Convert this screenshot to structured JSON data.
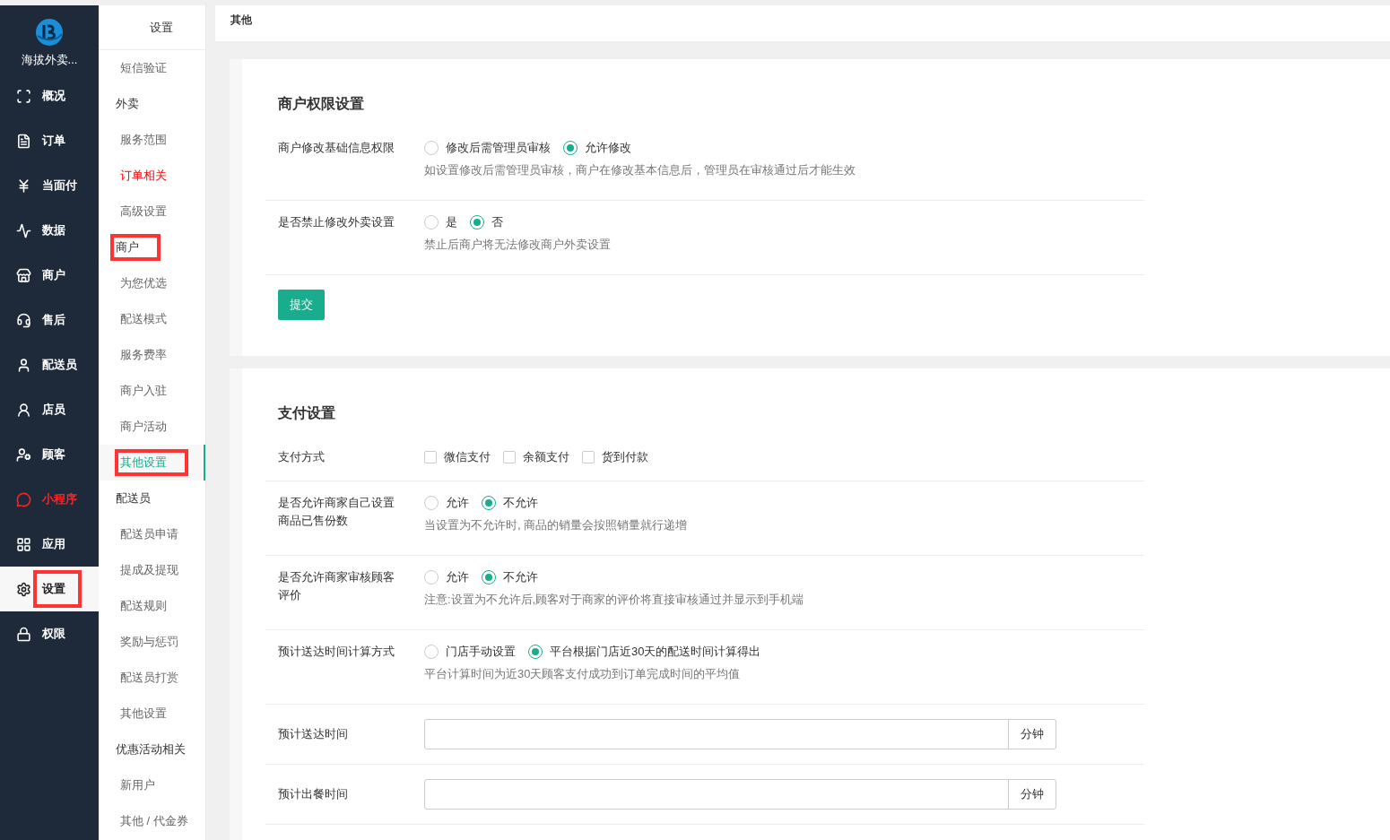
{
  "brand": {
    "name": "海拔外卖..."
  },
  "nav": [
    {
      "label": "概况",
      "selected": false,
      "highlighted": false
    },
    {
      "label": "订单",
      "selected": false,
      "highlighted": false
    },
    {
      "label": "当面付",
      "selected": false,
      "highlighted": false
    },
    {
      "label": "数据",
      "selected": false,
      "highlighted": false
    },
    {
      "label": "商户",
      "selected": false,
      "highlighted": false
    },
    {
      "label": "售后",
      "selected": false,
      "highlighted": false
    },
    {
      "label": "配送员",
      "selected": false,
      "highlighted": false
    },
    {
      "label": "店员",
      "selected": false,
      "highlighted": false
    },
    {
      "label": "顾客",
      "selected": false,
      "highlighted": false
    },
    {
      "label": "小程序",
      "selected": false,
      "highlighted": true
    },
    {
      "label": "应用",
      "selected": false,
      "highlighted": false
    },
    {
      "label": "设置",
      "selected": true,
      "highlighted": false,
      "annotated": true
    },
    {
      "label": "权限",
      "selected": false,
      "highlighted": false
    }
  ],
  "submenu": {
    "title": "设置",
    "items": [
      {
        "kind": "item",
        "label": "短信验证",
        "selected": false,
        "highlighted": false
      },
      {
        "kind": "group",
        "label": "外卖",
        "selected": false,
        "highlighted": false
      },
      {
        "kind": "item",
        "label": "服务范围",
        "selected": false,
        "highlighted": false
      },
      {
        "kind": "item",
        "label": "订单相关",
        "selected": false,
        "highlighted": true
      },
      {
        "kind": "item",
        "label": "高级设置",
        "selected": false,
        "highlighted": false
      },
      {
        "kind": "group",
        "label": "商户",
        "selected": false,
        "highlighted": false,
        "annotated": true
      },
      {
        "kind": "item",
        "label": "为您优选",
        "selected": false,
        "highlighted": false
      },
      {
        "kind": "item",
        "label": "配送模式",
        "selected": false,
        "highlighted": false
      },
      {
        "kind": "item",
        "label": "服务费率",
        "selected": false,
        "highlighted": false
      },
      {
        "kind": "item",
        "label": "商户入驻",
        "selected": false,
        "highlighted": false
      },
      {
        "kind": "item",
        "label": "商户活动",
        "selected": false,
        "highlighted": false
      },
      {
        "kind": "item",
        "label": "其他设置",
        "selected": true,
        "highlighted": false,
        "annotated": true
      },
      {
        "kind": "group",
        "label": "配送员",
        "selected": false,
        "highlighted": false
      },
      {
        "kind": "item",
        "label": "配送员申请",
        "selected": false,
        "highlighted": false
      },
      {
        "kind": "item",
        "label": "提成及提现",
        "selected": false,
        "highlighted": false
      },
      {
        "kind": "item",
        "label": "配送规则",
        "selected": false,
        "highlighted": false
      },
      {
        "kind": "item",
        "label": "奖励与惩罚",
        "selected": false,
        "highlighted": false
      },
      {
        "kind": "item",
        "label": "配送员打赏",
        "selected": false,
        "highlighted": false
      },
      {
        "kind": "item",
        "label": "其他设置",
        "selected": false,
        "highlighted": false
      },
      {
        "kind": "group",
        "label": "优惠活动相关",
        "selected": false,
        "highlighted": false
      },
      {
        "kind": "item",
        "label": "新用户",
        "selected": false,
        "highlighted": false
      },
      {
        "kind": "item",
        "label": "其他 / 代金券",
        "selected": false,
        "highlighted": false
      }
    ]
  },
  "breadcrumb": "其他",
  "sections": [
    {
      "title": "商户权限设置",
      "submit": "提交",
      "rows": [
        {
          "kind": "radio",
          "label": "商户修改基础信息权限",
          "options": [
            {
              "label": "修改后需管理员审核",
              "selected": false
            },
            {
              "label": "允许修改",
              "selected": true
            }
          ],
          "help": "如设置修改后需管理员审核，商户在修改基本信息后，管理员在审核通过后才能生效"
        },
        {
          "kind": "radio",
          "label": "是否禁止修改外卖设置",
          "options": [
            {
              "label": "是",
              "selected": false
            },
            {
              "label": "否",
              "selected": true
            }
          ],
          "help": "禁止后商户将无法修改商户外卖设置"
        }
      ]
    },
    {
      "title": "支付设置",
      "rows": [
        {
          "kind": "checkbox",
          "label": "支付方式",
          "options": [
            {
              "label": "微信支付",
              "checked": false
            },
            {
              "label": "余额支付",
              "checked": false
            },
            {
              "label": "货到付款",
              "checked": false
            }
          ]
        },
        {
          "kind": "radio",
          "label": "是否允许商家自己设置商品已售份数",
          "options": [
            {
              "label": "允许",
              "selected": false
            },
            {
              "label": "不允许",
              "selected": true
            }
          ],
          "help": "当设置为不允许时, 商品的销量会按照销量就行递增"
        },
        {
          "kind": "radio",
          "label": "是否允许商家审核顾客评价",
          "options": [
            {
              "label": "允许",
              "selected": false
            },
            {
              "label": "不允许",
              "selected": true
            }
          ],
          "help": "注意:设置为不允许后,顾客对于商家的评价将直接审核通过并显示到手机端"
        },
        {
          "kind": "radio",
          "label": "预计送达时间计算方式",
          "options": [
            {
              "label": "门店手动设置",
              "selected": false
            },
            {
              "label": "平台根据门店近30天的配送时间计算得出",
              "selected": true
            }
          ],
          "help": "平台计算时间为近30天顾客支付成功到订单完成时间的平均值"
        },
        {
          "kind": "input",
          "label": "预计送达时间",
          "unit": "分钟"
        },
        {
          "kind": "input",
          "label": "预计出餐时间",
          "unit": "分钟"
        }
      ]
    }
  ]
}
